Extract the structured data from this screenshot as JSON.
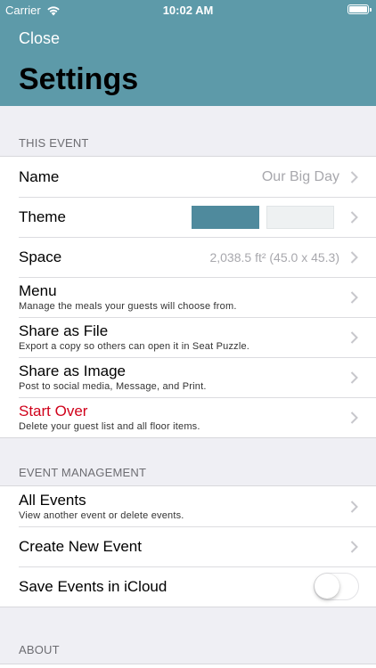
{
  "status_bar": {
    "carrier": "Carrier",
    "time": "10:02 AM"
  },
  "header": {
    "close_label": "Close",
    "title": "Settings"
  },
  "sections": {
    "this_event": {
      "title": "THIS EVENT",
      "name": {
        "label": "Name",
        "value": "Our Big Day"
      },
      "theme": {
        "label": "Theme",
        "color_primary": "#4f8a9d",
        "color_secondary": "#eef1f2"
      },
      "space": {
        "label": "Space",
        "value": "2,038.5 ft² (45.0 x 45.3)"
      },
      "menu": {
        "label": "Menu",
        "subtitle": "Manage the meals your guests will choose from."
      },
      "share_file": {
        "label": "Share as File",
        "subtitle": "Export a copy so others can open it in Seat Puzzle."
      },
      "share_image": {
        "label": "Share as Image",
        "subtitle": "Post to social media, Message, and Print."
      },
      "start_over": {
        "label": "Start Over",
        "subtitle": "Delete your guest list and all floor items."
      }
    },
    "event_management": {
      "title": "EVENT MANAGEMENT",
      "all_events": {
        "label": "All Events",
        "subtitle": "View another event or delete events."
      },
      "create_event": {
        "label": "Create New Event"
      },
      "icloud": {
        "label": "Save Events in iCloud",
        "enabled": false
      }
    },
    "about": {
      "title": "ABOUT"
    }
  },
  "colors": {
    "header": "#5d9aa9",
    "destructive": "#d0021b",
    "background": "#efeff4"
  }
}
